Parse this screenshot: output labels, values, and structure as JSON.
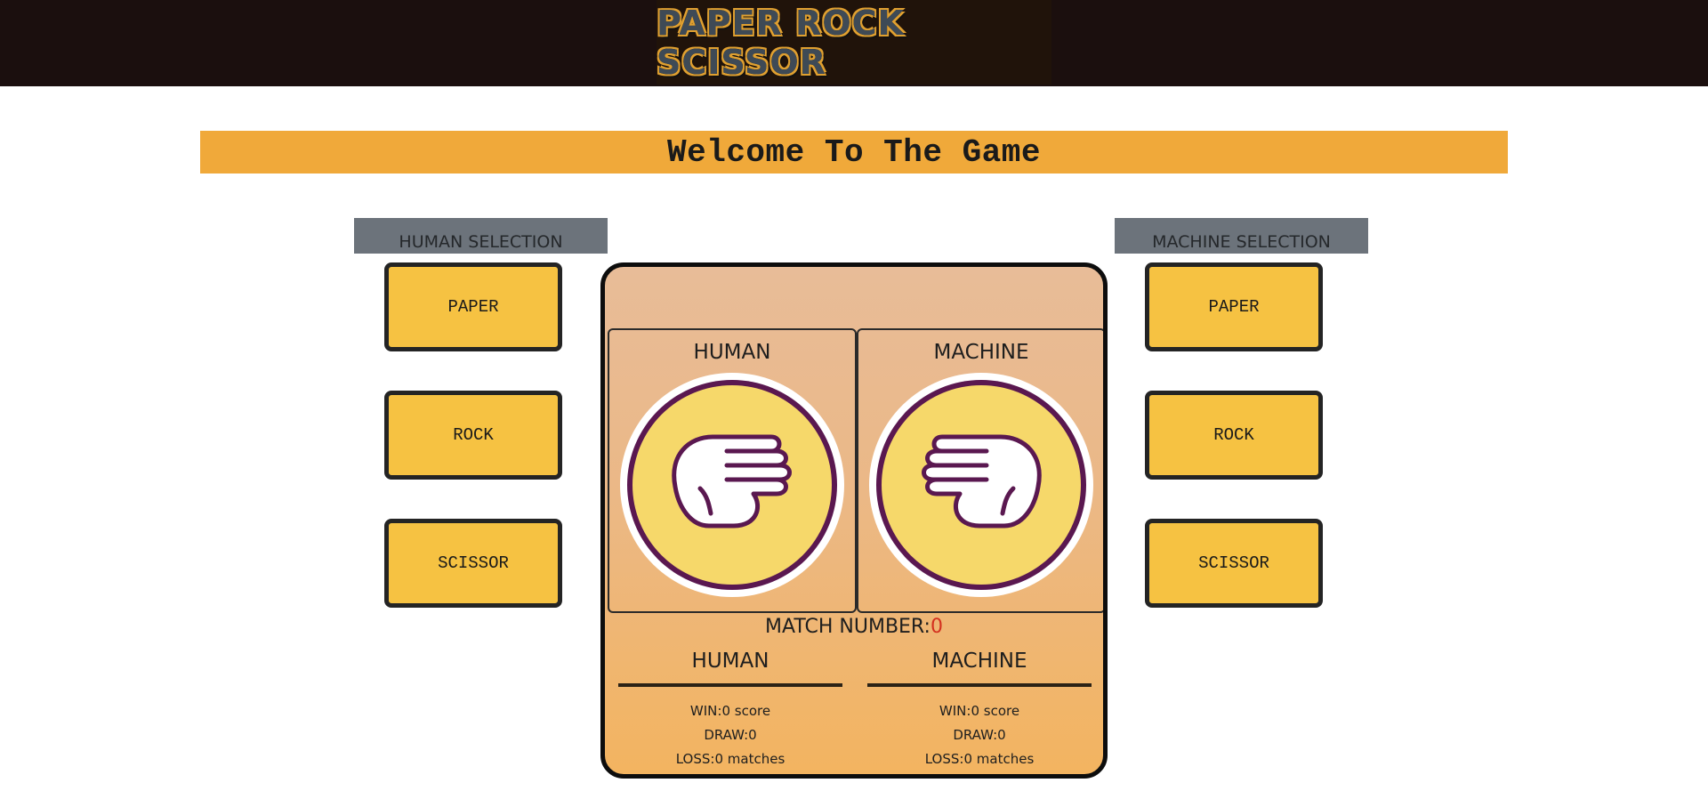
{
  "header": {
    "logo_text": "PAPER ROCK SCISSOR"
  },
  "banner": {
    "title": "Welcome To The Game"
  },
  "human_selection": {
    "title": "HUMAN SELECTION",
    "options": [
      "PAPER",
      "ROCK",
      "SCISSOR"
    ]
  },
  "machine_selection": {
    "title": "MACHINE SELECTION",
    "options": [
      "PAPER",
      "ROCK",
      "SCISSOR"
    ]
  },
  "arena": {
    "human_label": "HUMAN",
    "machine_label": "MACHINE",
    "human_hand_icon": "rock-hand-icon",
    "machine_hand_icon": "rock-hand-icon",
    "match_label": "MATCH NUMBER:",
    "match_number": "0"
  },
  "scoreboard": {
    "human": {
      "title": "HUMAN",
      "win": "WIN:0 score",
      "draw": "DRAW:0",
      "loss": "LOSS:0 matches"
    },
    "machine": {
      "title": "MACHINE",
      "win": "WIN:0 score",
      "draw": "DRAW:0",
      "loss": "LOSS:0 matches"
    }
  },
  "colors": {
    "topbar": "#1b0f0e",
    "banner": "#f0a93a",
    "button": "#f6c242",
    "selection_header": "#6c737b",
    "hand_outline": "#5a1850",
    "circle_fill": "#f6d86a",
    "match_number": "#d4301f"
  }
}
